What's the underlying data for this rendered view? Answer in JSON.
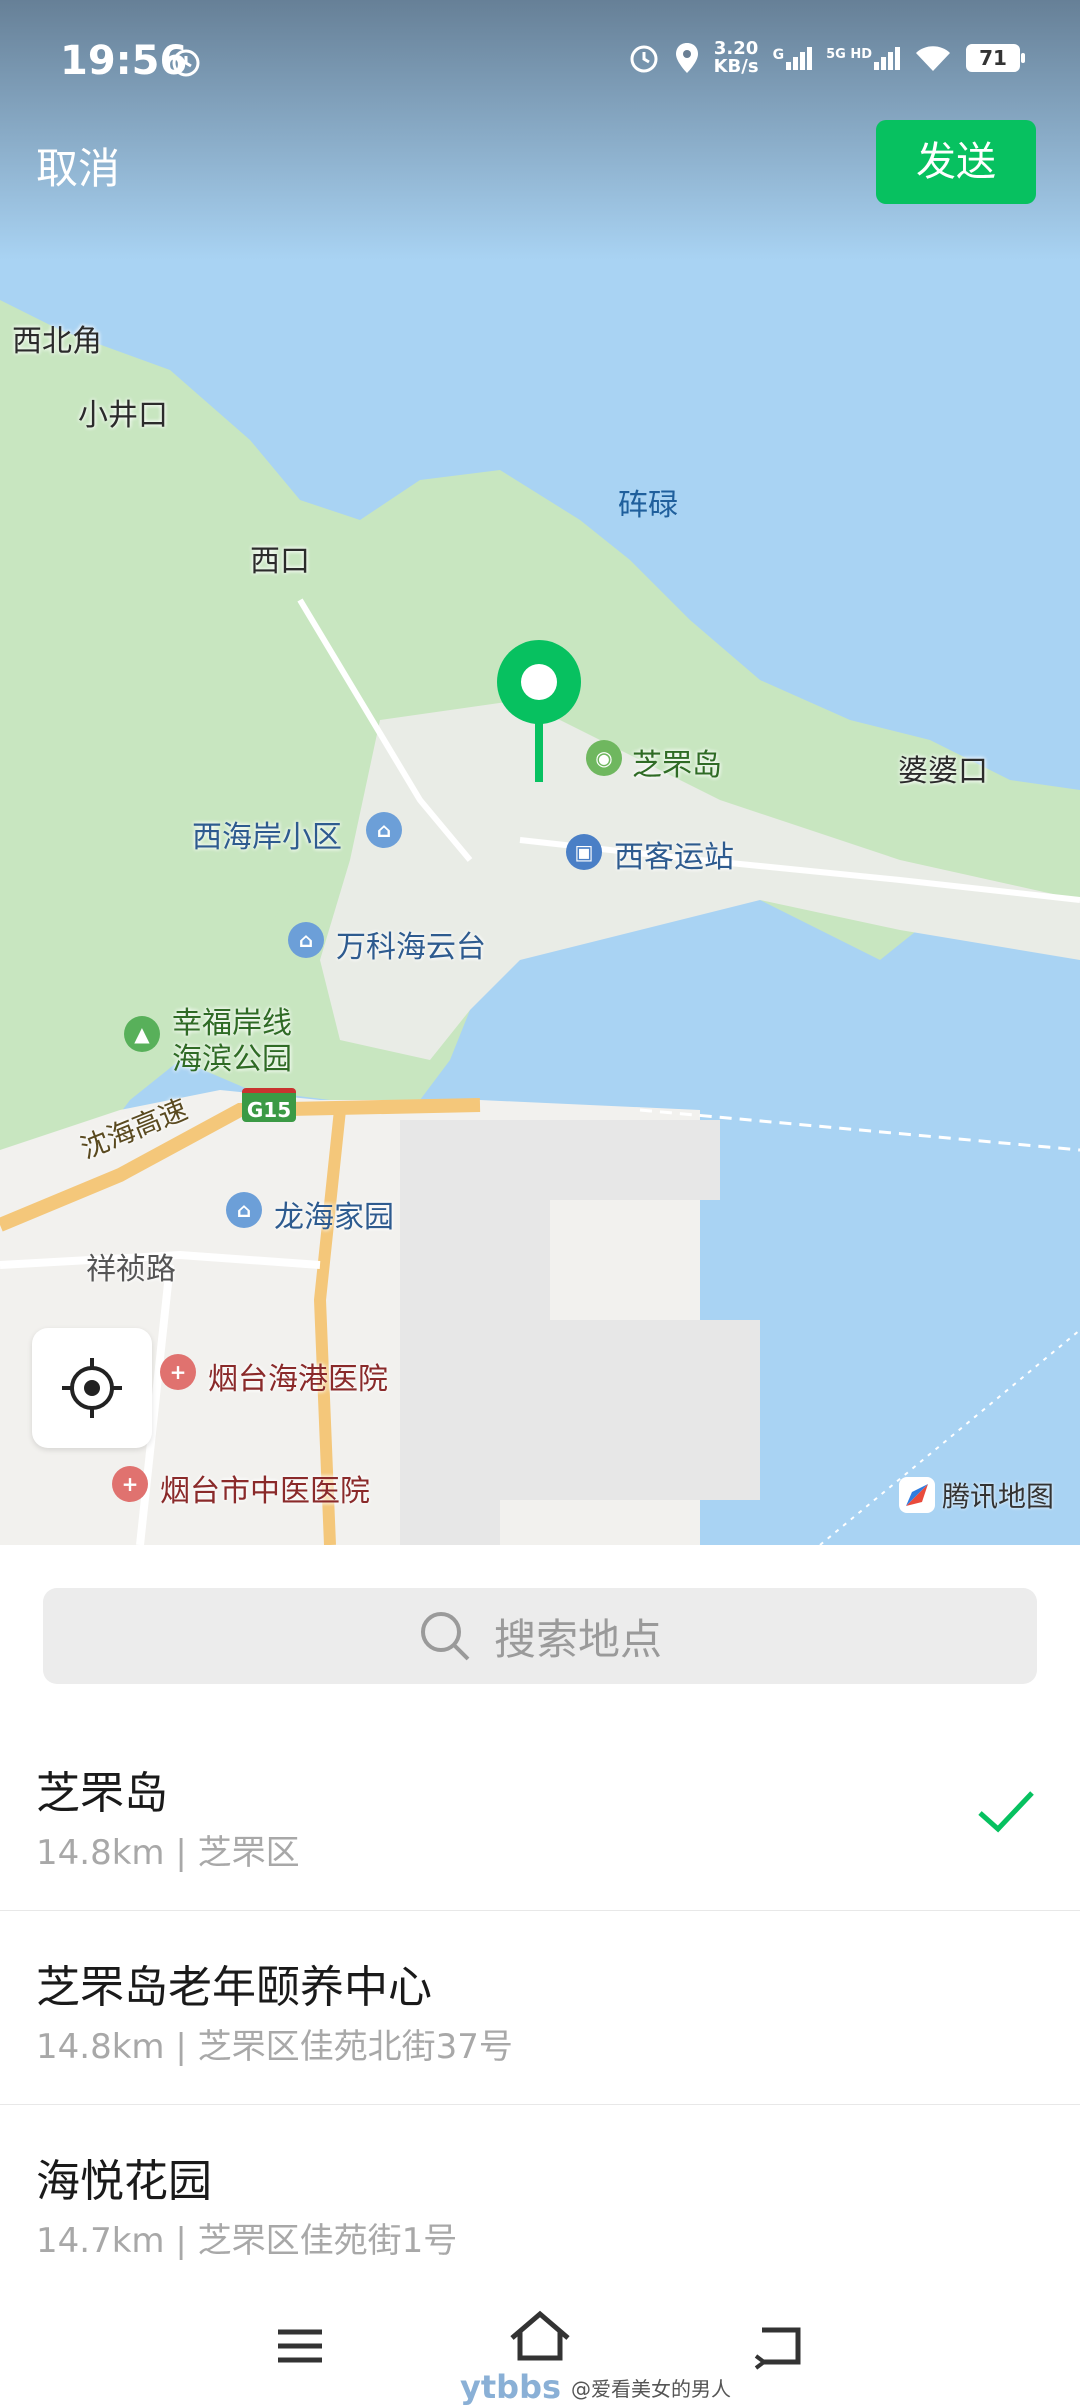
{
  "status": {
    "time": "19:56",
    "net_speed_top": "3.20",
    "net_speed_unit": "KB/s",
    "signal_label_1": "G",
    "signal_label_2": "5G HD",
    "battery": "71"
  },
  "header": {
    "cancel_label": "取消",
    "send_label": "发送"
  },
  "map": {
    "labels": {
      "xibeijiao": "西北角",
      "xiaojingkou": "小井口",
      "xikou": "西口",
      "lulu": "砗碌",
      "zhifudao": "芝罘岛",
      "popokou": "婆婆口",
      "xihaian": "西海岸小区",
      "xikeyunzhan": "西客运站",
      "wanke": "万科海云台",
      "xingfu_line1": "幸福岸线",
      "xingfu_line2": "海滨公园",
      "shenhai": "沈海高速",
      "g15": "G15",
      "longhai": "龙海家园",
      "xiangzhen": "祥祯路",
      "haigang": "烟台海港医院",
      "zhongyi": "烟台市中医医院"
    },
    "provider": "腾讯地图"
  },
  "search": {
    "placeholder": "搜索地点"
  },
  "results": [
    {
      "name": "芝罘岛",
      "sub": "14.8km | 芝罘区",
      "selected": true
    },
    {
      "name": "芝罘岛老年颐养中心",
      "sub": "14.8km | 芝罘区佳苑北街37号",
      "selected": false
    },
    {
      "name": "海悦花园",
      "sub": "14.7km | 芝罘区佳苑街1号",
      "selected": false
    }
  ],
  "watermark": {
    "brand": "ytbbs",
    "handle": "@爱看美女的男人"
  },
  "colors": {
    "accent": "#07c160",
    "water": "#a9d3f3",
    "land": "#c8e6c0",
    "urban": "#f2f1ee"
  }
}
